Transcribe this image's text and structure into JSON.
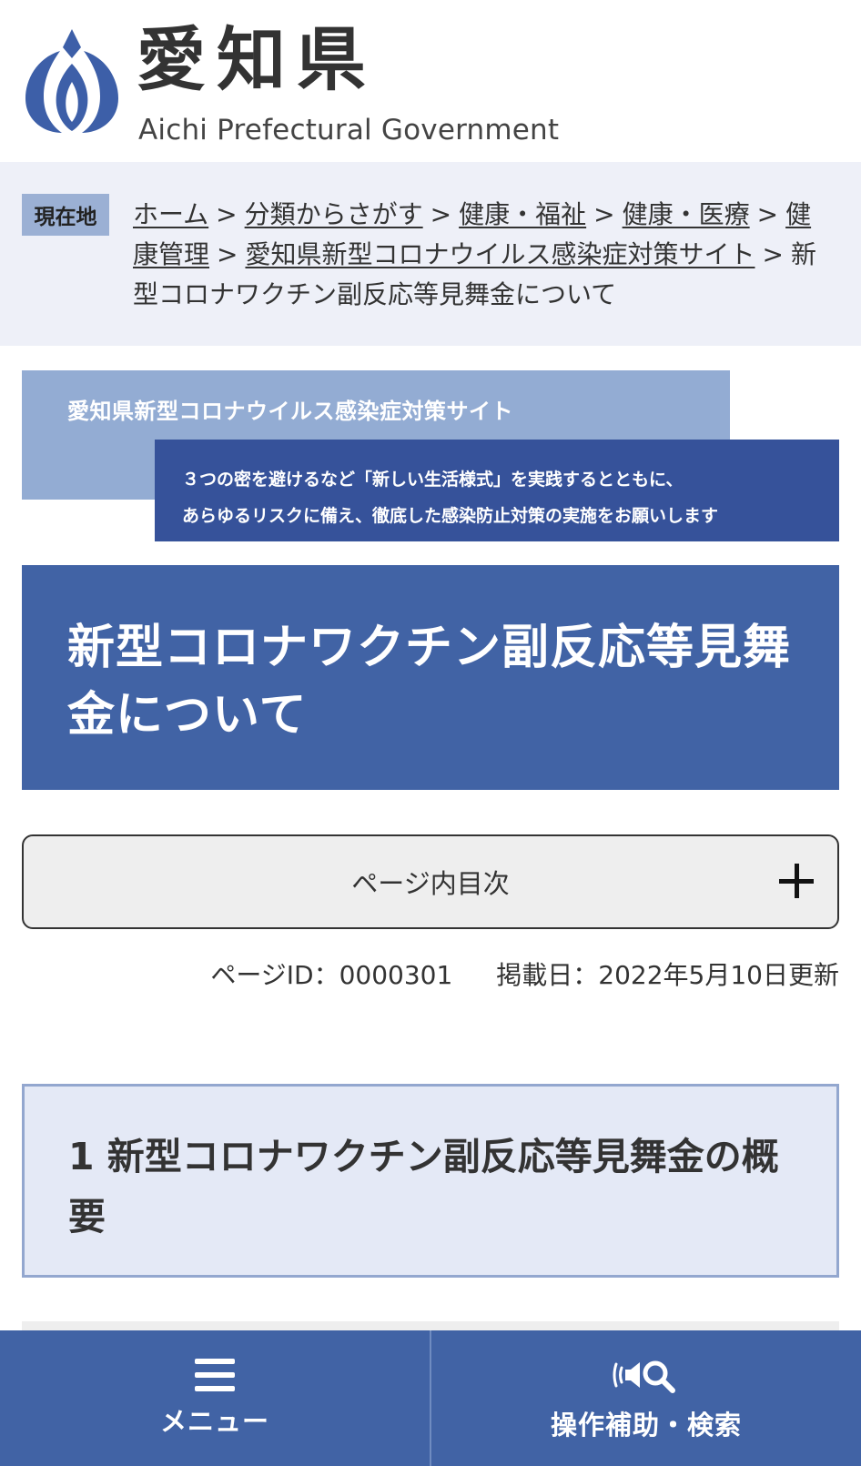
{
  "header": {
    "title": "愛知県",
    "subtitle": "Aichi Prefectural Government"
  },
  "breadcrumb": {
    "badge": "現在地",
    "items": [
      "ホーム",
      "分類からさがす",
      "健康・福祉",
      "健康・医療",
      "健康管理",
      "愛知県新型コロナウイルス感染症対策サイト"
    ],
    "current": "新型コロナワクチン副反応等見舞金について",
    "separator": ">"
  },
  "banner": {
    "title": "愛知県新型コロナウイルス感染症対策サイト",
    "line1": "３つの密を避けるなど「新しい生活様式」を実践するとともに、",
    "line2": "あらゆるリスクに備え、徹底した感染防止対策の実施をお願いします"
  },
  "page_title": "新型コロナワクチン副反応等見舞金について",
  "toc": {
    "label": "ページ内目次",
    "icon": "plus-icon"
  },
  "meta": {
    "page_id": "ページID：0000301",
    "date": "掲載日：2022年5月10日更新"
  },
  "section": {
    "heading": "1 新型コロナワクチン副反応等見舞金の概要"
  },
  "bottom_nav": {
    "menu_label": "メニュー",
    "assist_label": "操作補助・検索"
  },
  "colors": {
    "brand_blue": "#4163a5",
    "banner_light": "#93acd3",
    "banner_dark": "#36529a",
    "breadcrumb_bg": "#eef0f8",
    "section_bg": "#e4e9f6"
  }
}
